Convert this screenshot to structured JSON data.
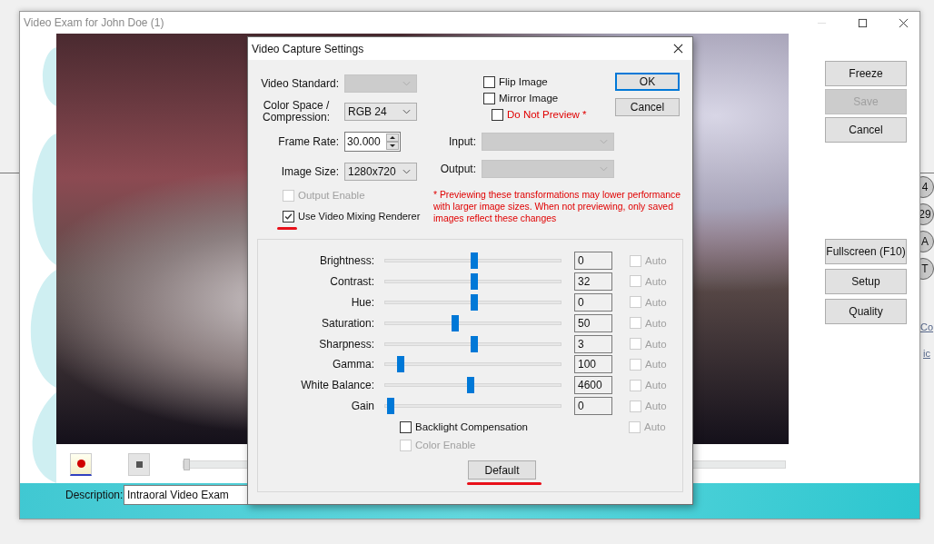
{
  "main_window": {
    "title": "Video Exam for John Doe (1)"
  },
  "capture_buttons": [
    {
      "label": "Freeze",
      "disabled": false
    },
    {
      "label": "Save",
      "disabled": true
    },
    {
      "label": "Cancel",
      "disabled": false
    }
  ],
  "view_buttons": [
    {
      "label": "Fullscreen (F10)",
      "disabled": false
    },
    {
      "label": "Setup",
      "disabled": false
    },
    {
      "label": "Quality",
      "disabled": false
    }
  ],
  "playback": {
    "level": 0
  },
  "description": {
    "label": "Description:",
    "value": "Intraoral Video Exam"
  },
  "background_app": {
    "badges": [
      "4",
      "29",
      "A",
      "T"
    ],
    "links": [
      "Co",
      "ic"
    ]
  },
  "dialog": {
    "title": "Video Capture Settings",
    "video_standard": {
      "label": "Video Standard:",
      "disabled": true
    },
    "color_space": {
      "label": "Color Space / Compression:",
      "value": "RGB 24",
      "disabled": false
    },
    "frame_rate": {
      "label": "Frame Rate:",
      "value": "30.000"
    },
    "image_size": {
      "label": "Image Size:",
      "value": "1280x720",
      "disabled": false
    },
    "output_enable": {
      "label": "Output Enable",
      "checked": false,
      "disabled": true
    },
    "use_vmr": {
      "label": "Use Video Mixing Renderer",
      "checked": true,
      "disabled": false,
      "marked": true
    },
    "flip": {
      "label": "Flip Image",
      "checked": false
    },
    "mirror": {
      "label": "Mirror Image",
      "checked": false
    },
    "do_not_preview": {
      "label": "Do Not Preview *",
      "checked": false
    },
    "input": {
      "label": "Input:",
      "disabled": true
    },
    "output": {
      "label": "Output:",
      "disabled": true
    },
    "note": "* Previewing these transformations may lower performance with larger image sizes. When not previewing, only saved images reflect these changes",
    "ok": "OK",
    "cancel": "Cancel",
    "adjustments": [
      {
        "label": "Brightness:",
        "level": 0.5,
        "value": "0",
        "auto": "Auto",
        "auto_disabled": true
      },
      {
        "label": "Contrast:",
        "level": 0.5,
        "value": "32",
        "auto": "Auto",
        "auto_disabled": true
      },
      {
        "label": "Hue:",
        "level": 0.5,
        "value": "0",
        "auto": "Auto",
        "auto_disabled": true
      },
      {
        "label": "Saturation:",
        "level": 0.39,
        "value": "50",
        "auto": "Auto",
        "auto_disabled": true
      },
      {
        "label": "Sharpness:",
        "level": 0.5,
        "value": "3",
        "auto": "Auto",
        "auto_disabled": true
      },
      {
        "label": "Gamma:",
        "level": 0.07,
        "value": "100",
        "auto": "Auto",
        "auto_disabled": true
      },
      {
        "label": "White Balance:",
        "level": 0.48,
        "value": "4600",
        "auto": "Auto",
        "auto_disabled": true
      },
      {
        "label": "Gain",
        "level": 0.01,
        "value": "0",
        "auto": "Auto",
        "auto_disabled": true
      }
    ],
    "backlight": {
      "label": "Backlight Compensation",
      "checked": false,
      "disabled": false,
      "auto": "Auto",
      "auto_disabled": true
    },
    "color_enable": {
      "label": "Color Enable",
      "checked": false,
      "disabled": true
    },
    "default_button": {
      "label": "Default",
      "marked": true
    }
  }
}
